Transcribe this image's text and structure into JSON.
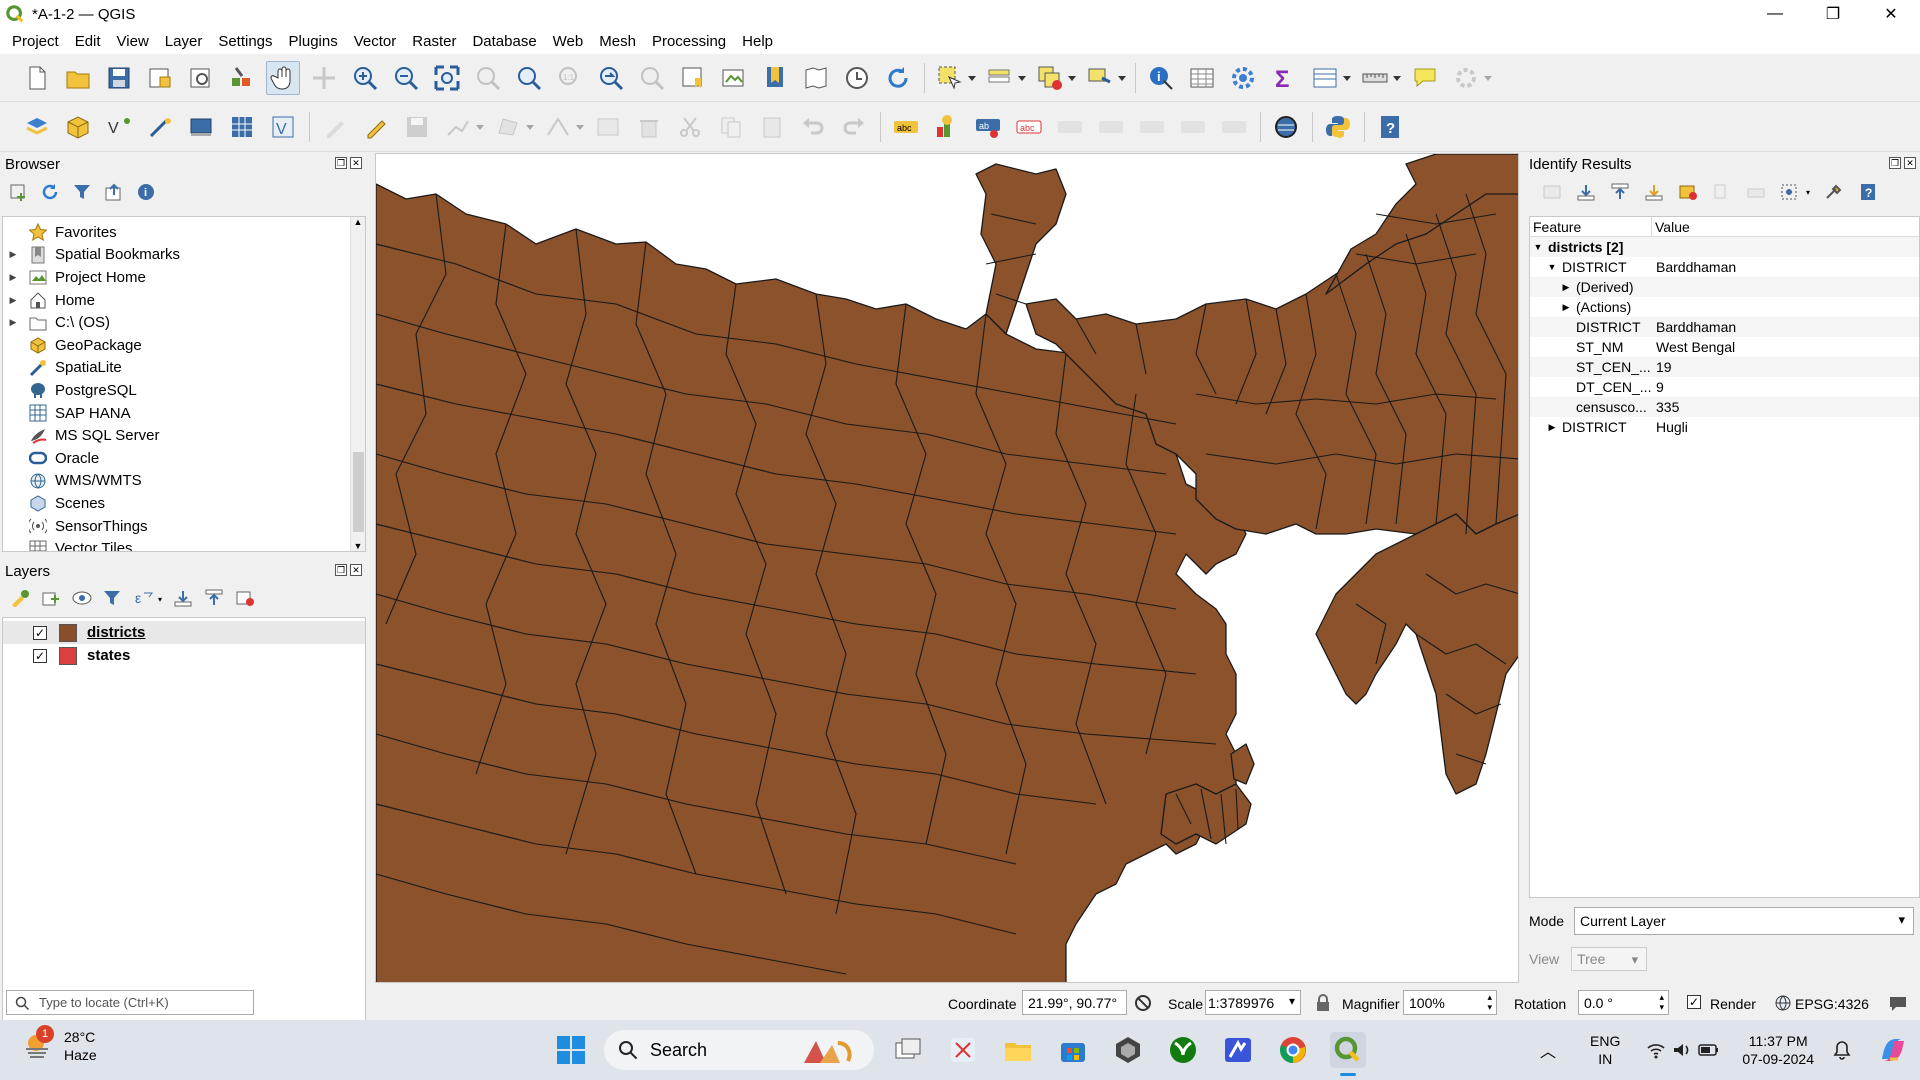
{
  "window": {
    "title": "*A-1-2 — QGIS",
    "minimize": "—",
    "maximize": "❐",
    "close": "✕"
  },
  "menu": [
    "Project",
    "Edit",
    "View",
    "Layer",
    "Settings",
    "Plugins",
    "Vector",
    "Raster",
    "Database",
    "Web",
    "Mesh",
    "Processing",
    "Help"
  ],
  "browser": {
    "title": "Browser",
    "items": [
      {
        "label": "Favorites",
        "icon": "star-icon",
        "expand": false
      },
      {
        "label": "Spatial Bookmarks",
        "icon": "bookmark-icon",
        "expand": true
      },
      {
        "label": "Project Home",
        "icon": "project-home-icon",
        "expand": true
      },
      {
        "label": "Home",
        "icon": "home-icon",
        "expand": true
      },
      {
        "label": "C:\\ (OS)",
        "icon": "drive-icon",
        "expand": true
      },
      {
        "label": "GeoPackage",
        "icon": "geopackage-icon",
        "expand": false
      },
      {
        "label": "SpatiaLite",
        "icon": "spatialite-icon",
        "expand": false
      },
      {
        "label": "PostgreSQL",
        "icon": "postgresql-icon",
        "expand": false
      },
      {
        "label": "SAP HANA",
        "icon": "sap-hana-icon",
        "expand": false
      },
      {
        "label": "MS SQL Server",
        "icon": "mssql-icon",
        "expand": false
      },
      {
        "label": "Oracle",
        "icon": "oracle-icon",
        "expand": false
      },
      {
        "label": "WMS/WMTS",
        "icon": "wms-icon",
        "expand": false
      },
      {
        "label": "Scenes",
        "icon": "scenes-icon",
        "expand": false
      },
      {
        "label": "SensorThings",
        "icon": "sensorthings-icon",
        "expand": false
      },
      {
        "label": "Vector Tiles",
        "icon": "vector-tiles-icon",
        "expand": false
      }
    ]
  },
  "layers": {
    "title": "Layers",
    "items": [
      {
        "name": "districts",
        "checked": true,
        "color": "#8b4e2c",
        "selected": true
      },
      {
        "name": "states",
        "checked": true,
        "color": "#d94040",
        "selected": false
      }
    ]
  },
  "identify": {
    "title": "Identify Results",
    "col_feature": "Feature",
    "col_value": "Value",
    "rows": [
      {
        "indent": 0,
        "arrow": "▼",
        "feature": "districts  [2]",
        "value": "",
        "bold": true
      },
      {
        "indent": 1,
        "arrow": "▼",
        "feature": "DISTRICT",
        "value": "Barddhaman",
        "bold": false
      },
      {
        "indent": 2,
        "arrow": "▶",
        "feature": "(Derived)",
        "value": "",
        "bold": false
      },
      {
        "indent": 2,
        "arrow": "▶",
        "feature": "(Actions)",
        "value": "",
        "bold": false
      },
      {
        "indent": 2,
        "arrow": "",
        "feature": "DISTRICT",
        "value": "Barddhaman",
        "bold": false
      },
      {
        "indent": 2,
        "arrow": "",
        "feature": "ST_NM",
        "value": "West Bengal",
        "bold": false
      },
      {
        "indent": 2,
        "arrow": "",
        "feature": "ST_CEN_...",
        "value": "19",
        "bold": false
      },
      {
        "indent": 2,
        "arrow": "",
        "feature": "DT_CEN_...",
        "value": "9",
        "bold": false
      },
      {
        "indent": 2,
        "arrow": "",
        "feature": "censusco...",
        "value": "335",
        "bold": false
      },
      {
        "indent": 1,
        "arrow": "▶",
        "feature": "DISTRICT",
        "value": "Hugli",
        "bold": false
      }
    ],
    "mode_label": "Mode",
    "mode_value": "Current Layer",
    "view_label": "View",
    "view_value": "Tree"
  },
  "status": {
    "locator_placeholder": "Type to locate (Ctrl+K)",
    "coordinate_label": "Coordinate",
    "coordinate_value": "21.99°, 90.77°",
    "scale_label": "Scale",
    "scale_value": "1:3789976",
    "magnifier_label": "Magnifier",
    "magnifier_value": "100%",
    "rotation_label": "Rotation",
    "rotation_value": "0.0 °",
    "render_label": "Render",
    "crs": "EPSG:4326"
  },
  "taskbar": {
    "weather_temp": "28°C",
    "weather_desc": "Haze",
    "weather_badge": "1",
    "search_label": "Search",
    "lang_top": "ENG",
    "lang_bottom": "IN",
    "time": "11:37 PM",
    "date": "07-09-2024"
  },
  "colors": {
    "district_fill": "#8b522b",
    "district_stroke": "#1a1a1a",
    "qgis_green": "#589632"
  }
}
